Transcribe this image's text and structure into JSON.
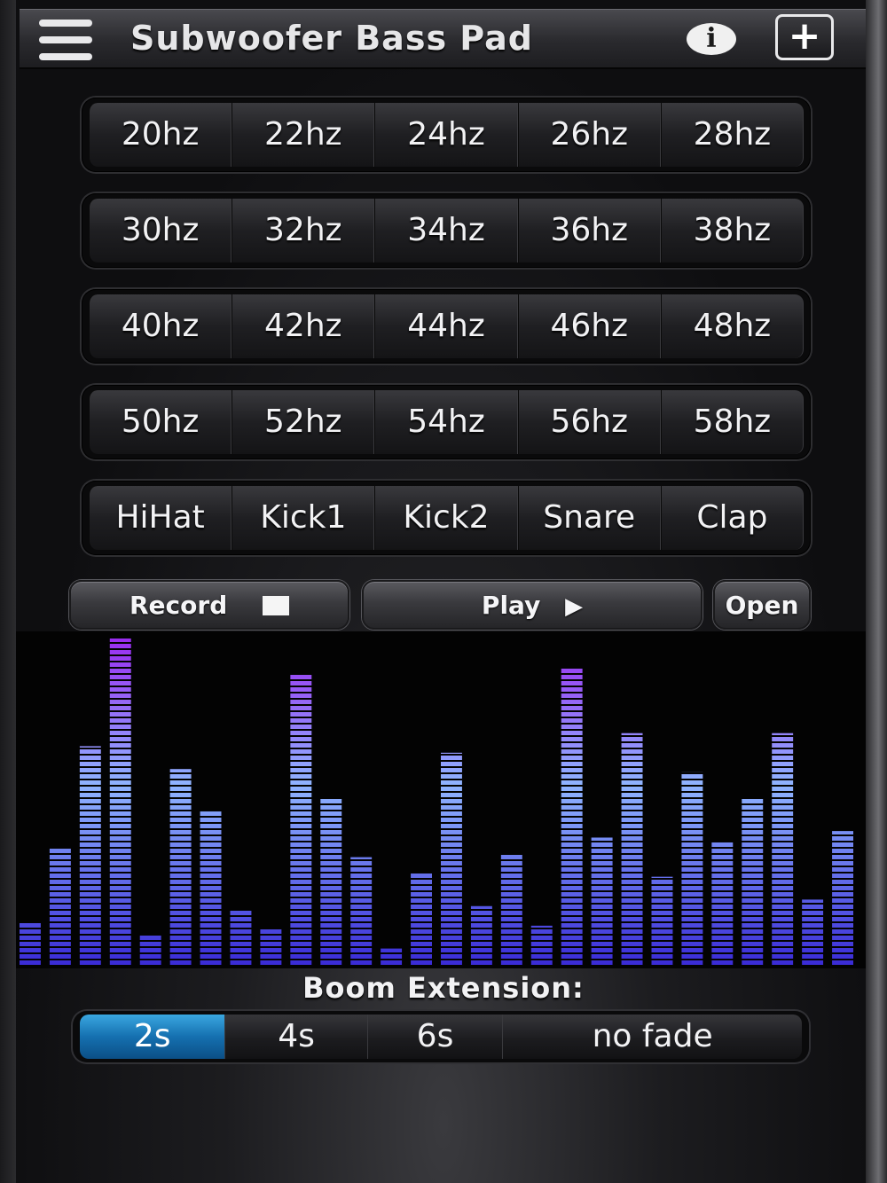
{
  "header": {
    "title": "Subwoofer Bass Pad",
    "icons": {
      "menu": "menu-icon",
      "info": "info-icon",
      "add": "plus-icon"
    },
    "info_glyph": "i",
    "add_glyph": "+"
  },
  "pads": [
    [
      "20hz",
      "22hz",
      "24hz",
      "26hz",
      "28hz"
    ],
    [
      "30hz",
      "32hz",
      "34hz",
      "36hz",
      "38hz"
    ],
    [
      "40hz",
      "42hz",
      "44hz",
      "46hz",
      "48hz"
    ],
    [
      "50hz",
      "52hz",
      "54hz",
      "56hz",
      "58hz"
    ],
    [
      "HiHat",
      "Kick1",
      "Kick2",
      "Snare",
      "Clap"
    ]
  ],
  "transport": {
    "record_label": "Record",
    "play_label": "Play",
    "play_glyph": "▶",
    "open_label": "Open"
  },
  "visualizer": {
    "levels": [
      0.13,
      0.36,
      0.67,
      1.0,
      0.09,
      0.6,
      0.47,
      0.17,
      0.11,
      0.89,
      0.51,
      0.33,
      0.05,
      0.28,
      0.65,
      0.18,
      0.34,
      0.12,
      0.91,
      0.39,
      0.71,
      0.27,
      0.59,
      0.38,
      0.51,
      0.71,
      0.2,
      0.41
    ],
    "colors": {
      "bottom": "#3a2bd6",
      "mid": "#8fb4ff",
      "top": "#9a2cf0"
    }
  },
  "boom": {
    "label": "Boom Extension:",
    "options": [
      "2s",
      "4s",
      "6s",
      "no fade"
    ],
    "selected": "2s",
    "active_color": "#1e86c8"
  }
}
